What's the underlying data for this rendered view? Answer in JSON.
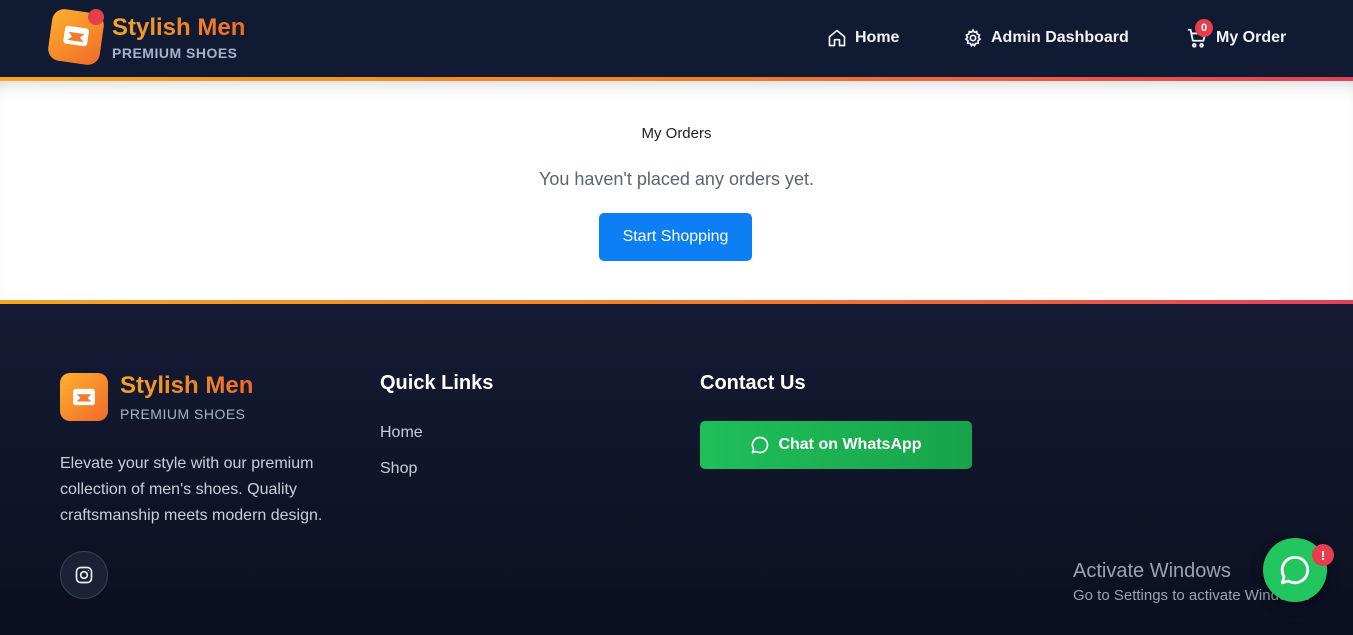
{
  "header": {
    "brand_title": "Stylish Men",
    "brand_subtitle": "PREMIUM SHOES",
    "nav": {
      "home": "Home",
      "admin": "Admin Dashboard",
      "orders": "My Order",
      "cart_count": "0"
    }
  },
  "main": {
    "title": "My Orders",
    "empty_message": "You haven't placed any orders yet.",
    "cta_label": "Start Shopping"
  },
  "footer": {
    "brand_title": "Stylish Men",
    "brand_subtitle": "PREMIUM SHOES",
    "description": "Elevate your style with our premium collection of men's shoes. Quality craftsmanship meets modern design.",
    "quick_links_title": "Quick Links",
    "quick_links": [
      "Home",
      "Shop"
    ],
    "contact_title": "Contact Us",
    "whatsapp_label": "Chat on WhatsApp"
  },
  "overlay": {
    "activate_title": "Activate Windows",
    "activate_subtitle": "Go to Settings to activate Windows.",
    "float_badge": "!"
  },
  "colors": {
    "header_bg": "#111a33",
    "accent_orange": "#f5a524",
    "accent_red": "#e53e4d",
    "primary_blue": "#0d7ff5",
    "whatsapp_green": "#22c55e"
  },
  "icons": {
    "logo": "shoe-box-icon",
    "home": "home-icon",
    "admin": "gear-icon",
    "orders": "cart-icon",
    "instagram": "instagram-icon",
    "whatsapp": "chat-bubble-icon"
  }
}
